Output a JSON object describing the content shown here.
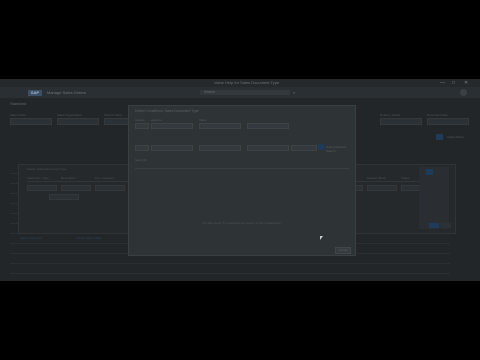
{
  "window": {
    "title": "Value Help for Sales Document Type",
    "controls": [
      "—",
      "□",
      "✕"
    ]
  },
  "shell": {
    "logo": "SAP",
    "app_title": "Manage Sales Orders",
    "search_placeholder": "Search"
  },
  "page": {
    "header": "Standard",
    "filters": [
      {
        "label": "Sales Order",
        "value": ""
      },
      {
        "label": "Sales Organization",
        "value": ""
      },
      {
        "label": "Sold-To Party",
        "value": ""
      },
      {
        "label": "Overall Status",
        "value": ""
      },
      {
        "label": "Created By",
        "value": ""
      },
      {
        "label": "Delivery Status",
        "value": ""
      },
      {
        "label": "Document Date",
        "value": ""
      }
    ],
    "adapt_filters": "Adapt Filters",
    "links": [
      "Sales Orders (0)",
      "Create Sales Order"
    ]
  },
  "value_help": {
    "title": "Select: Sales Document Type",
    "columns": [
      "Sales Doc. Type",
      "Description",
      "Doc. Category",
      "Number Range",
      "Item No. Incr.",
      "Screen Seq.",
      "Check Division",
      "Probability",
      "Ref. Mandatory",
      "Billing Block",
      "Delivery Block",
      "Status"
    ],
    "ok": "OK",
    "cancel": "Cancel"
  },
  "modal": {
    "title": "Define Conditions: Sales Document Type",
    "fields": [
      {
        "label": "Include"
      },
      {
        "label": "equal to"
      },
      {
        "label": "Value"
      }
    ],
    "hide_label": "Hide Advanced Search",
    "info": "Items (0)",
    "empty_text": "No data found. Try adjusting the search or filter parameters.",
    "footer_button": "Cancel"
  }
}
